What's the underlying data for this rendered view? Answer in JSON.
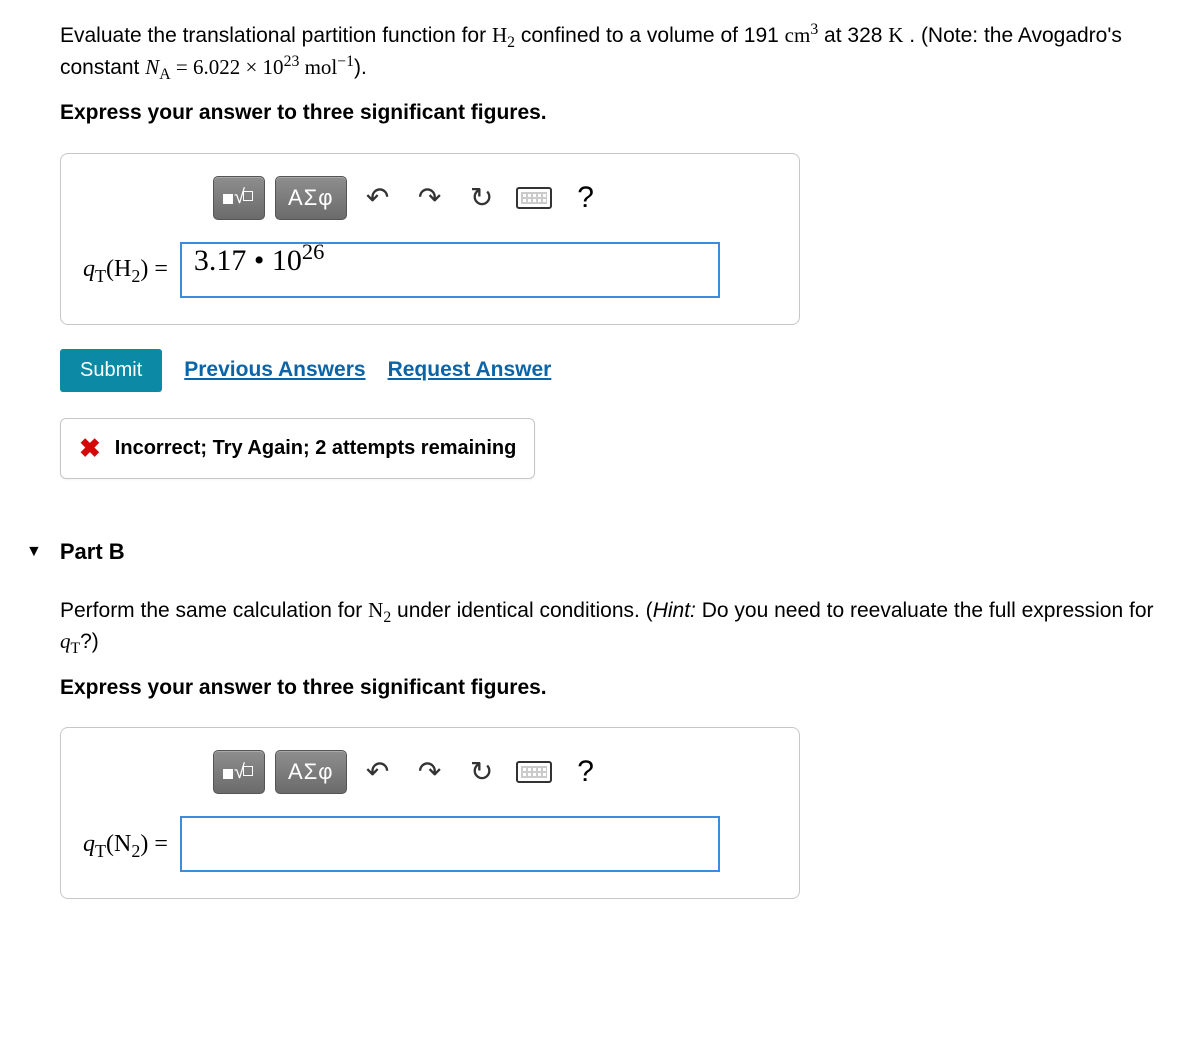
{
  "partA": {
    "question_html": "Evaluate the translational partition function for <span class='ser'>H<sub>2</sub></span> confined to a volume of 191 <span class='ser'>cm<sup>3</sup></span> at 328 <span class='ser'>K</span> . (Note: the Avogadro's constant <span class='ser'><i>N</i><sub>A</sub> = 6.022 × 10<sup>23</sup> mol<sup>−1</sup></span>).",
    "instruction": "Express your answer to three significant figures.",
    "answer_label_html": "<i>q</i><sub>T</sub>(H<sub>2</sub>) =",
    "answer_value_html": "3.17 • 10<sup>26</sup>",
    "submit": "Submit",
    "prev": "Previous Answers",
    "req": "Request Answer",
    "feedback": "Incorrect; Try Again; 2 attempts remaining"
  },
  "partB": {
    "title": "Part B",
    "question_html": "Perform the same calculation for <span class='ser'>N<sub>2</sub></span> under identical conditions. (<span class='hint-ital'>Hint:</span> Do you need to reevaluate the full expression for <span class='ser'><i>q</i><sub>T</sub></span>?)",
    "instruction": "Express your answer to three significant figures.",
    "answer_label_html": "<i>q</i><sub>T</sub>(N<sub>2</sub>) =",
    "answer_value_html": ""
  },
  "toolbar": {
    "greek": "ΑΣφ"
  }
}
